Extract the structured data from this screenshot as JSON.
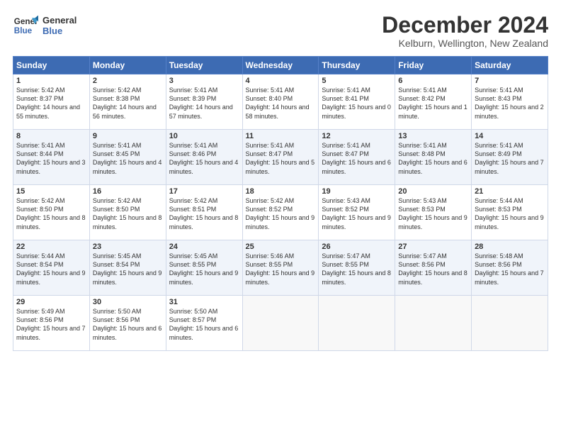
{
  "logo": {
    "line1": "General",
    "line2": "Blue"
  },
  "title": "December 2024",
  "subtitle": "Kelburn, Wellington, New Zealand",
  "headers": [
    "Sunday",
    "Monday",
    "Tuesday",
    "Wednesday",
    "Thursday",
    "Friday",
    "Saturday"
  ],
  "weeks": [
    [
      {
        "day": "1",
        "sunrise": "5:42 AM",
        "sunset": "8:37 PM",
        "daylight": "14 hours and 55 minutes."
      },
      {
        "day": "2",
        "sunrise": "5:42 AM",
        "sunset": "8:38 PM",
        "daylight": "14 hours and 56 minutes."
      },
      {
        "day": "3",
        "sunrise": "5:41 AM",
        "sunset": "8:39 PM",
        "daylight": "14 hours and 57 minutes."
      },
      {
        "day": "4",
        "sunrise": "5:41 AM",
        "sunset": "8:40 PM",
        "daylight": "14 hours and 58 minutes."
      },
      {
        "day": "5",
        "sunrise": "5:41 AM",
        "sunset": "8:41 PM",
        "daylight": "15 hours and 0 minutes."
      },
      {
        "day": "6",
        "sunrise": "5:41 AM",
        "sunset": "8:42 PM",
        "daylight": "15 hours and 1 minute."
      },
      {
        "day": "7",
        "sunrise": "5:41 AM",
        "sunset": "8:43 PM",
        "daylight": "15 hours and 2 minutes."
      }
    ],
    [
      {
        "day": "8",
        "sunrise": "5:41 AM",
        "sunset": "8:44 PM",
        "daylight": "15 hours and 3 minutes."
      },
      {
        "day": "9",
        "sunrise": "5:41 AM",
        "sunset": "8:45 PM",
        "daylight": "15 hours and 4 minutes."
      },
      {
        "day": "10",
        "sunrise": "5:41 AM",
        "sunset": "8:46 PM",
        "daylight": "15 hours and 4 minutes."
      },
      {
        "day": "11",
        "sunrise": "5:41 AM",
        "sunset": "8:47 PM",
        "daylight": "15 hours and 5 minutes."
      },
      {
        "day": "12",
        "sunrise": "5:41 AM",
        "sunset": "8:47 PM",
        "daylight": "15 hours and 6 minutes."
      },
      {
        "day": "13",
        "sunrise": "5:41 AM",
        "sunset": "8:48 PM",
        "daylight": "15 hours and 6 minutes."
      },
      {
        "day": "14",
        "sunrise": "5:41 AM",
        "sunset": "8:49 PM",
        "daylight": "15 hours and 7 minutes."
      }
    ],
    [
      {
        "day": "15",
        "sunrise": "5:42 AM",
        "sunset": "8:50 PM",
        "daylight": "15 hours and 8 minutes."
      },
      {
        "day": "16",
        "sunrise": "5:42 AM",
        "sunset": "8:50 PM",
        "daylight": "15 hours and 8 minutes."
      },
      {
        "day": "17",
        "sunrise": "5:42 AM",
        "sunset": "8:51 PM",
        "daylight": "15 hours and 8 minutes."
      },
      {
        "day": "18",
        "sunrise": "5:42 AM",
        "sunset": "8:52 PM",
        "daylight": "15 hours and 9 minutes."
      },
      {
        "day": "19",
        "sunrise": "5:43 AM",
        "sunset": "8:52 PM",
        "daylight": "15 hours and 9 minutes."
      },
      {
        "day": "20",
        "sunrise": "5:43 AM",
        "sunset": "8:53 PM",
        "daylight": "15 hours and 9 minutes."
      },
      {
        "day": "21",
        "sunrise": "5:44 AM",
        "sunset": "8:53 PM",
        "daylight": "15 hours and 9 minutes."
      }
    ],
    [
      {
        "day": "22",
        "sunrise": "5:44 AM",
        "sunset": "8:54 PM",
        "daylight": "15 hours and 9 minutes."
      },
      {
        "day": "23",
        "sunrise": "5:45 AM",
        "sunset": "8:54 PM",
        "daylight": "15 hours and 9 minutes."
      },
      {
        "day": "24",
        "sunrise": "5:45 AM",
        "sunset": "8:55 PM",
        "daylight": "15 hours and 9 minutes."
      },
      {
        "day": "25",
        "sunrise": "5:46 AM",
        "sunset": "8:55 PM",
        "daylight": "15 hours and 9 minutes."
      },
      {
        "day": "26",
        "sunrise": "5:47 AM",
        "sunset": "8:55 PM",
        "daylight": "15 hours and 8 minutes."
      },
      {
        "day": "27",
        "sunrise": "5:47 AM",
        "sunset": "8:56 PM",
        "daylight": "15 hours and 8 minutes."
      },
      {
        "day": "28",
        "sunrise": "5:48 AM",
        "sunset": "8:56 PM",
        "daylight": "15 hours and 7 minutes."
      }
    ],
    [
      {
        "day": "29",
        "sunrise": "5:49 AM",
        "sunset": "8:56 PM",
        "daylight": "15 hours and 7 minutes."
      },
      {
        "day": "30",
        "sunrise": "5:50 AM",
        "sunset": "8:56 PM",
        "daylight": "15 hours and 6 minutes."
      },
      {
        "day": "31",
        "sunrise": "5:50 AM",
        "sunset": "8:57 PM",
        "daylight": "15 hours and 6 minutes."
      },
      null,
      null,
      null,
      null
    ]
  ]
}
